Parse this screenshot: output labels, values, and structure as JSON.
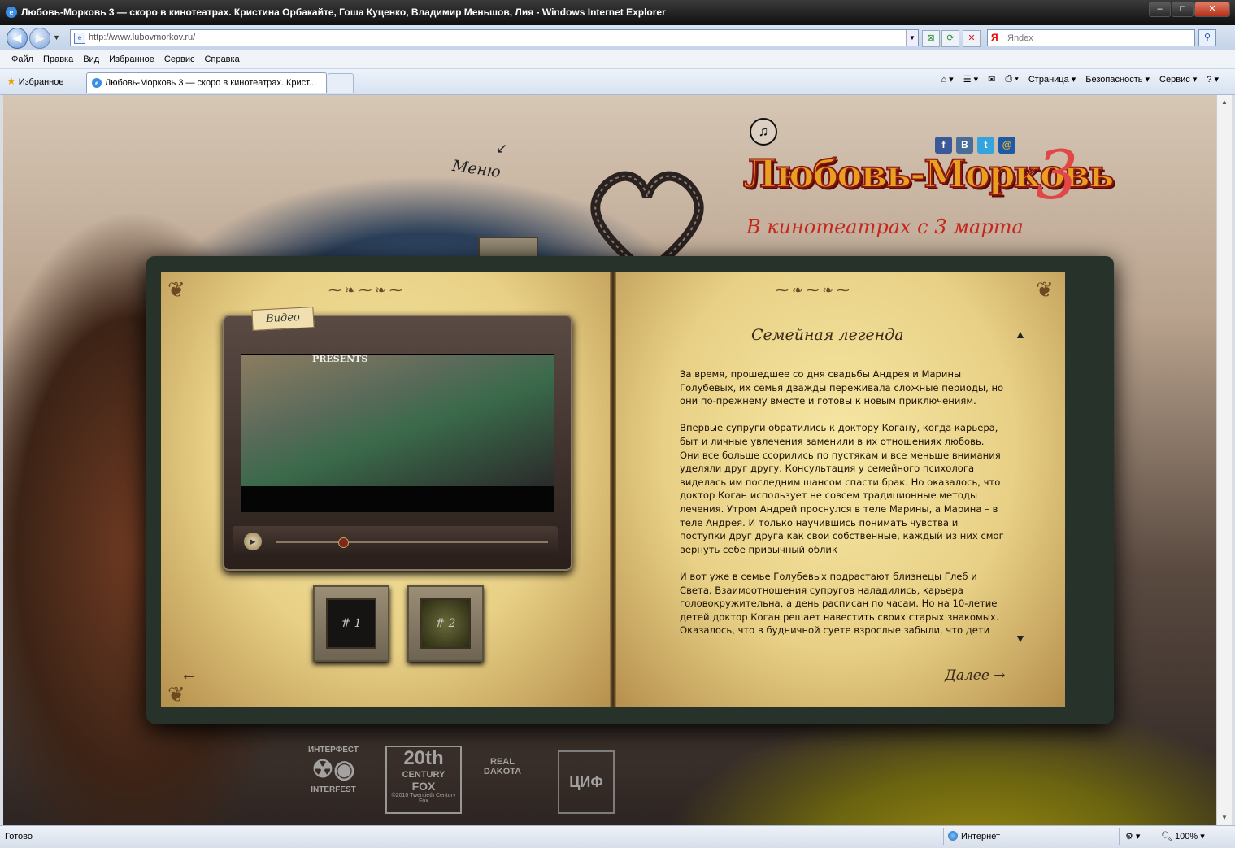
{
  "window": {
    "title": "Любовь-Морковь 3 — скоро в кинотеатрах. Кристина Орбакайте, Гоша Куценко, Владимир Меньшов, Лия - Windows Internet Explorer"
  },
  "address_bar": {
    "url": "http://www.lubovmorkov.ru/",
    "search_placeholder": "Яndex",
    "search_engine_mark": "Я"
  },
  "menu": [
    "Файл",
    "Правка",
    "Вид",
    "Избранное",
    "Сервис",
    "Справка"
  ],
  "tabs": {
    "favorites_label": "Избранное",
    "active_tab_title": "Любовь-Морковь 3 — скоро в кинотеатрах. Крист..."
  },
  "command_bar": {
    "page": "Страница",
    "safety": "Безопасность",
    "tools": "Сервис"
  },
  "status_bar": {
    "status": "Готово",
    "zone": "Интернет",
    "zoom": "100%"
  },
  "site": {
    "menu_link": "Меню",
    "logo_text": "Любовь-Морковь",
    "logo_number": "3",
    "tagline": "В кинотеатрах с 3 марта",
    "socials": [
      "f",
      "B",
      "t",
      "@"
    ],
    "video": {
      "tag": "Видео",
      "presents_text": "PRESENTS",
      "thumbs": [
        "# 1",
        "# 2"
      ]
    },
    "story": {
      "title": "Семейная легенда",
      "paragraphs": [
        "За время, прошедшее со дня свадьбы Андрея и Марины Голубевых, их семья дважды переживала сложные периоды, но они по-прежнему вместе и готовы к новым приключениям.",
        "Впервые супруги обратились к доктору Когану, когда карьера, быт и личные увлечения заменили в их отношениях любовь. Они все больше ссорились по пустякам и все меньше внимания уделяли друг другу. Консультация у семейного психолога виделась им последним шансом спасти брак. Но оказалось, что доктор Коган использует не совсем традиционные методы лечения. Утром Андрей проснулся в теле Марины, а Марина – в теле Андрея. И только научившись понимать чувства и поступки друг друга как свои собственные, каждый из них смог вернуть себе привычный облик",
        "И вот уже в семье Голубевых подрастают близнецы Глеб и Света. Взаимоотношения супругов наладились, карьера головокружительна, а день расписан по часам. Но на 10-летие детей доктор Коган решает навестить своих старых знакомых. Оказалось, что в будничной суете взрослые забыли, что дети"
      ],
      "next_label": "Далее"
    },
    "partners": {
      "interfest_top": "ИНТЕРФЕСТ",
      "interfest_bottom": "INTERFEST",
      "fox_big": "20th",
      "fox_mid": "CENTURY",
      "fox_small": "FOX",
      "fox_copyright": "©2010 Twentieth Century Fox",
      "real_dakota_1": "REAL",
      "real_dakota_2": "DAKOTA",
      "tsif": "ЦИФ"
    }
  },
  "colors": {
    "logo_fill": "#e8a020",
    "logo_stroke": "#8b1612",
    "tagline": "#c6261e",
    "number": "#e24747"
  }
}
